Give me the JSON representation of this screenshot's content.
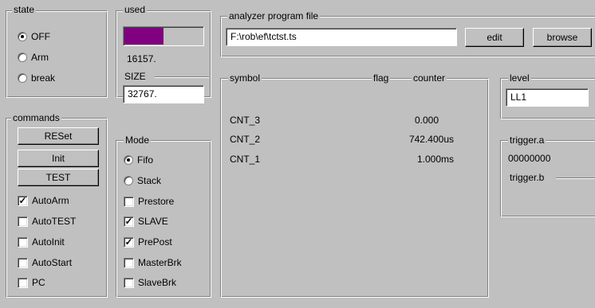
{
  "state": {
    "title": "state",
    "options": [
      {
        "label": "OFF",
        "selected": true
      },
      {
        "label": "Arm",
        "selected": false
      },
      {
        "label": "break",
        "selected": false
      }
    ]
  },
  "used": {
    "title": "used",
    "value": "16157.",
    "fill_fraction": 0.49,
    "bar_color": "#800080"
  },
  "size": {
    "title": "SIZE",
    "value": "32767."
  },
  "commands": {
    "title": "commands",
    "buttons": [
      "RESet",
      "Init",
      "TEST"
    ],
    "checks": [
      {
        "label": "AutoArm",
        "checked": true
      },
      {
        "label": "AutoTEST",
        "checked": false
      },
      {
        "label": "AutoInit",
        "checked": false
      },
      {
        "label": "AutoStart",
        "checked": false
      },
      {
        "label": "PC",
        "checked": false
      }
    ]
  },
  "mode": {
    "title": "Mode",
    "radios": [
      {
        "label": "Fifo",
        "selected": true
      },
      {
        "label": "Stack",
        "selected": false
      }
    ],
    "checks": [
      {
        "label": "Prestore",
        "checked": false
      },
      {
        "label": "SLAVE",
        "checked": true
      },
      {
        "label": "PrePost",
        "checked": true
      },
      {
        "label": "MasterBrk",
        "checked": false
      },
      {
        "label": "SlaveBrk",
        "checked": false
      }
    ]
  },
  "program": {
    "title": "analyzer program file",
    "path": "F:\\rob\\ef\\tctst.ts",
    "edit_label": "edit",
    "browse_label": "browse"
  },
  "counters": {
    "col_symbol": "symbol",
    "col_flag": "flag",
    "col_counter": "counter",
    "rows": [
      {
        "symbol": "CNT_3",
        "counter": "0.000"
      },
      {
        "symbol": "CNT_2",
        "counter": "742.400us"
      },
      {
        "symbol": "CNT_1",
        "counter": "1.000ms"
      }
    ]
  },
  "level": {
    "title": "level",
    "value": "LL1"
  },
  "trigger": {
    "a_label": "trigger.a",
    "a_value": "00000000",
    "b_label": "trigger.b"
  }
}
